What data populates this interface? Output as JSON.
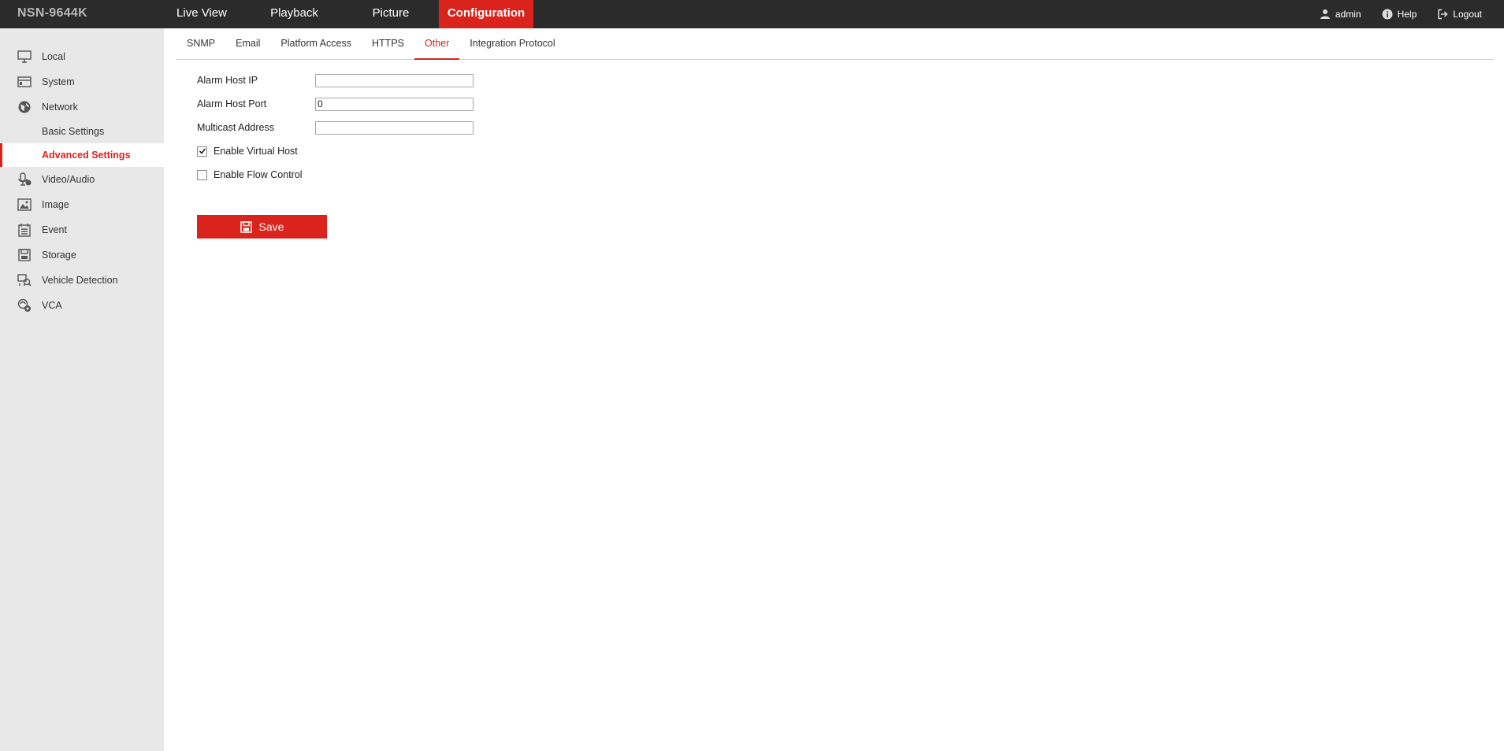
{
  "brand": "NSN-9644K",
  "nav": {
    "live_view": "Live View",
    "playback": "Playback",
    "picture": "Picture",
    "configuration": "Configuration"
  },
  "user": {
    "name": "admin",
    "help": "Help",
    "logout": "Logout"
  },
  "sidebar": {
    "local": "Local",
    "system": "System",
    "network": "Network",
    "basic_settings": "Basic Settings",
    "advanced_settings": "Advanced Settings",
    "video_audio": "Video/Audio",
    "image": "Image",
    "event": "Event",
    "storage": "Storage",
    "vehicle_detection": "Vehicle Detection",
    "vca": "VCA"
  },
  "tabs": {
    "snmp": "SNMP",
    "email": "Email",
    "platform_access": "Platform Access",
    "https": "HTTPS",
    "other": "Other",
    "integration_protocol": "Integration Protocol"
  },
  "form": {
    "alarm_host_ip_label": "Alarm Host IP",
    "alarm_host_ip_value": "",
    "alarm_host_port_label": "Alarm Host Port",
    "alarm_host_port_value": "0",
    "multicast_address_label": "Multicast Address",
    "multicast_address_value": "",
    "enable_virtual_host_label": "Enable Virtual Host",
    "enable_virtual_host_checked": true,
    "enable_flow_control_label": "Enable Flow Control",
    "enable_flow_control_checked": false,
    "save_label": "Save"
  },
  "colors": {
    "accent": "#d9231c",
    "topbar": "#2b2b2b",
    "sidebar": "#e8e8e8"
  }
}
